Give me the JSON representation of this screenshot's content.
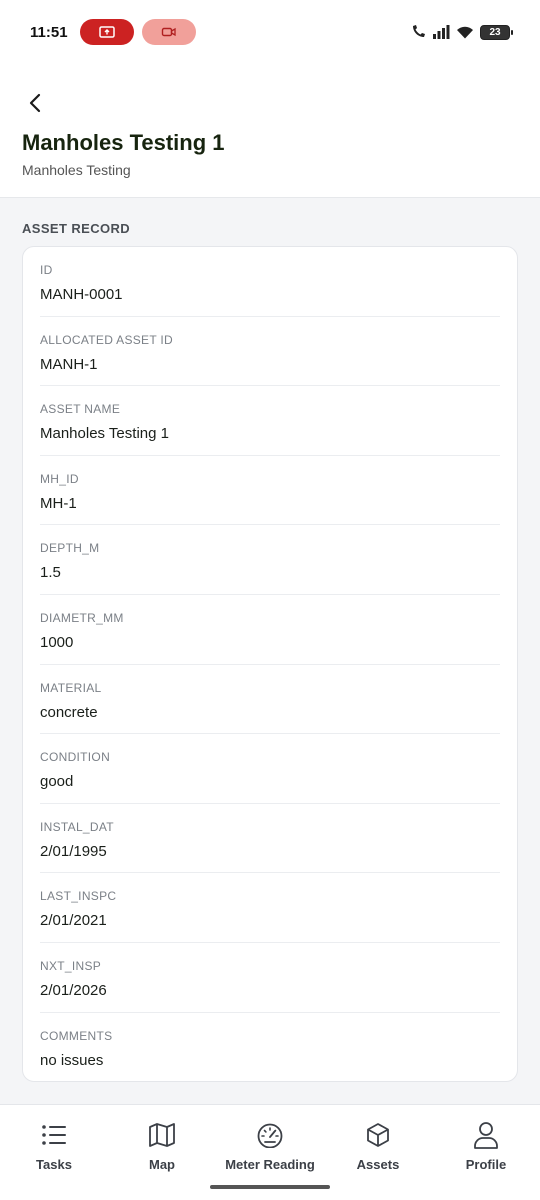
{
  "status_bar": {
    "time": "11:51",
    "battery": "23"
  },
  "header": {
    "title": "Manholes Testing 1",
    "subtitle": "Manholes Testing"
  },
  "section": {
    "label": "ASSET RECORD"
  },
  "fields": [
    {
      "label": "ID",
      "value": "MANH-0001"
    },
    {
      "label": "ALLOCATED ASSET ID",
      "value": "MANH-1"
    },
    {
      "label": "ASSET NAME",
      "value": "Manholes Testing 1"
    },
    {
      "label": "MH_ID",
      "value": "MH-1"
    },
    {
      "label": "DEPTH_M",
      "value": "1.5"
    },
    {
      "label": "DIAMETR_MM",
      "value": "1000"
    },
    {
      "label": "MATERIAL",
      "value": "concrete"
    },
    {
      "label": "CONDITION",
      "value": "good"
    },
    {
      "label": "INSTAL_DAT",
      "value": "2/01/1995"
    },
    {
      "label": "LAST_INSPC",
      "value": "2/01/2021"
    },
    {
      "label": "NXT_INSP",
      "value": "2/01/2026"
    },
    {
      "label": "COMMENTS",
      "value": "no issues"
    }
  ],
  "nav": [
    {
      "label": "Tasks",
      "icon": "list-icon"
    },
    {
      "label": "Map",
      "icon": "map-icon"
    },
    {
      "label": "Meter Reading",
      "icon": "gauge-icon"
    },
    {
      "label": "Assets",
      "icon": "cube-icon"
    },
    {
      "label": "Profile",
      "icon": "person-icon"
    }
  ]
}
